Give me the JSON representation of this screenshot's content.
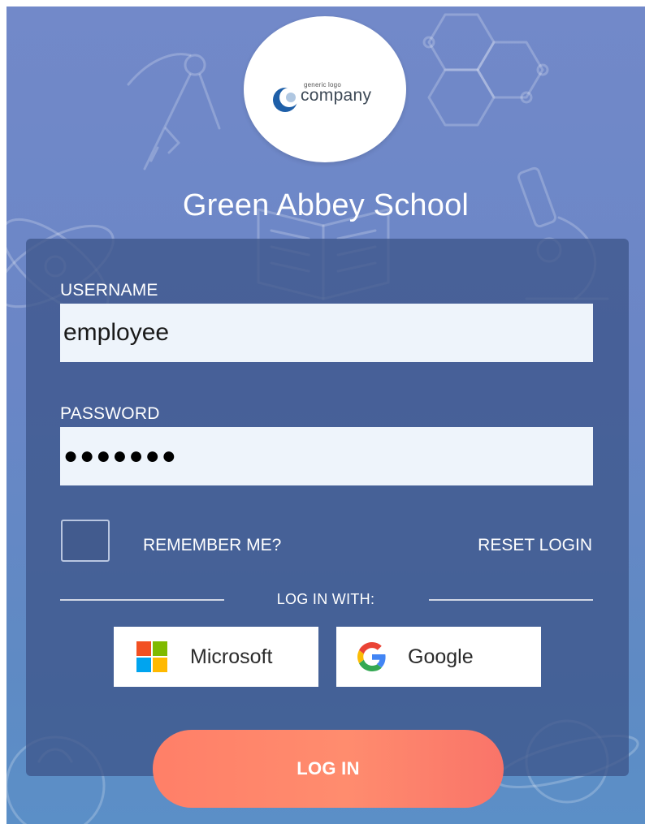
{
  "logo": {
    "small_text": "generic logo",
    "big_text": "company"
  },
  "school": {
    "name": "Green Abbey School"
  },
  "form": {
    "username_label": "USERNAME",
    "username_value": "employee",
    "password_label": "PASSWORD",
    "password_masked": "●●●●●●●",
    "remember_label": "REMEMBER ME?",
    "remember_checked": false,
    "reset_label": "RESET LOGIN",
    "login_with_label": "LOG IN WITH:",
    "login_button_label": "LOG IN"
  },
  "sso": {
    "microsoft_label": "Microsoft",
    "google_label": "Google"
  },
  "icons": [
    "microsoft-logo-icon",
    "google-logo-icon",
    "company-logo-swoosh-icon"
  ],
  "colors": {
    "background": "#6a86c6",
    "card": "#3e568a",
    "input_bg": "#eef4fb",
    "login_button": "#ff8c6e",
    "microsoft_red": "#f25022",
    "microsoft_green": "#7fba00",
    "microsoft_blue": "#00a4ef",
    "microsoft_yellow": "#ffb900"
  }
}
